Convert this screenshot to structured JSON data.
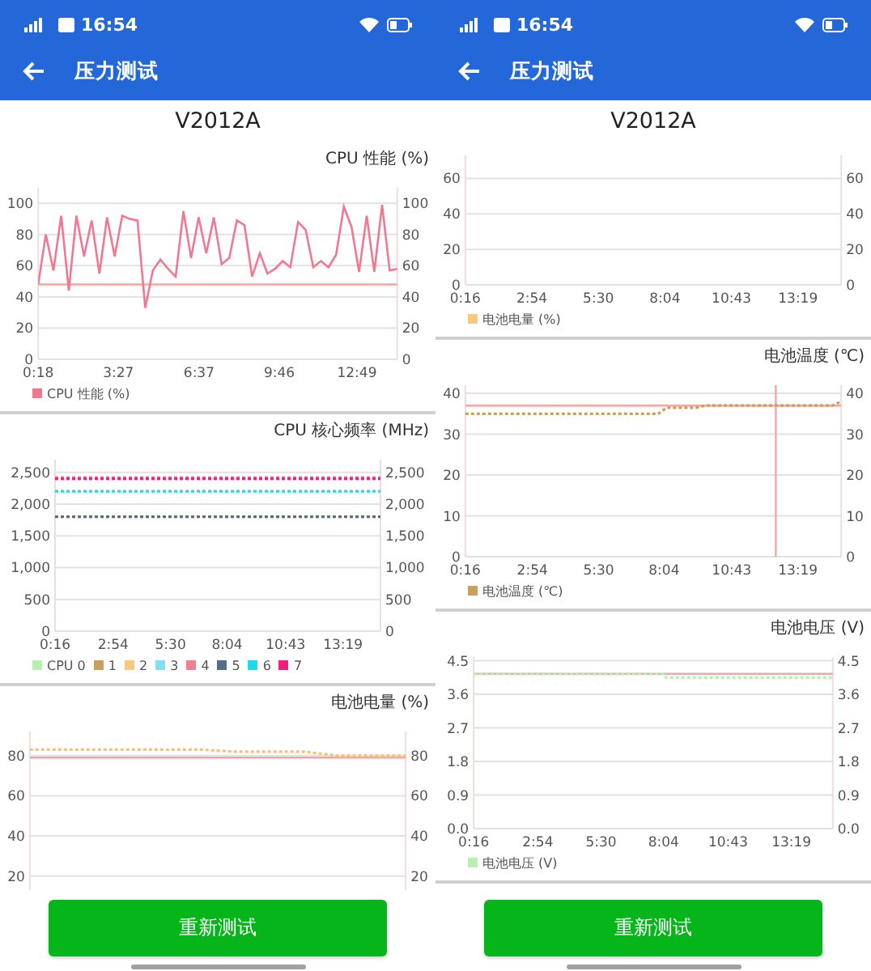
{
  "phones": [
    {
      "status_bar": {
        "time": "16:54"
      },
      "app_bar": {
        "title": "压力测试"
      },
      "device": "V2012A",
      "charts": [
        {
          "chart_data": {
            "type": "line",
            "title": "CPU 性能 (%)",
            "grid": true,
            "legend": "bottom",
            "x": [
              18,
              36,
              54,
              72,
              90,
              108,
              126,
              144,
              162,
              180,
              198,
              216,
              234,
              252,
              270,
              288,
              306,
              324,
              342,
              360,
              378,
              396,
              414,
              432,
              450,
              468,
              486,
              504,
              522,
              540,
              558,
              576,
              594,
              612,
              630,
              648,
              666,
              684,
              702,
              720,
              738,
              756,
              774,
              792,
              810,
              828,
              846,
              864
            ],
            "xlim": [
              18,
              864
            ],
            "ylim": [
              0,
              110
            ],
            "y2lim": [
              0,
              110
            ],
            "yticks": [
              0,
              20,
              40,
              60,
              80,
              100
            ],
            "y2ticks": [
              0,
              20,
              40,
              60,
              80,
              100
            ],
            "xticks": [
              {
                "value": 18,
                "label": "0:18"
              },
              {
                "value": 207,
                "label": "3:27"
              },
              {
                "value": 397,
                "label": "6:37"
              },
              {
                "value": 586,
                "label": "9:46"
              },
              {
                "value": 769,
                "label": "12:49"
              }
            ],
            "series": [
              {
                "name": "CPU 性能 (%)",
                "color": "#f07890",
                "line_style": "solid",
                "values": [
                  48,
                  80,
                  57,
                  92,
                  44,
                  92,
                  66,
                  89,
                  55,
                  91,
                  66,
                  92,
                  90,
                  89,
                  33,
                  57,
                  64,
                  58,
                  53,
                  95,
                  65,
                  91,
                  68,
                  91,
                  61,
                  65,
                  89,
                  86,
                  53,
                  68,
                  55,
                  58,
                  63,
                  59,
                  88,
                  83,
                  59,
                  63,
                  59,
                  67,
                  98,
                  85,
                  56,
                  92,
                  56,
                  99,
                  57,
                  58
                ]
              }
            ],
            "ref_lines": [
              {
                "axis": "y",
                "value": 48
              }
            ]
          }
        },
        {
          "chart_data": {
            "type": "line",
            "title": "CPU 核心频率 (MHz)",
            "grid": true,
            "legend": "bottom",
            "x": [
              16,
              901
            ],
            "xlim": [
              16,
              901
            ],
            "ylim": [
              0,
              2700
            ],
            "y2lim": [
              0,
              2700
            ],
            "yticks": [
              0,
              500,
              {
                "value": 1000,
                "label": "1,000"
              },
              {
                "value": 1500,
                "label": "1,500"
              },
              {
                "value": 2000,
                "label": "2,000"
              },
              {
                "value": 2500,
                "label": "2,500"
              }
            ],
            "y2ticks": [
              0,
              500,
              {
                "value": 1000,
                "label": "1,000"
              },
              {
                "value": 1500,
                "label": "1,500"
              },
              {
                "value": 2000,
                "label": "2,000"
              },
              {
                "value": 2500,
                "label": "2,500"
              }
            ],
            "xticks": [
              {
                "value": 16,
                "label": "0:16"
              },
              {
                "value": 174,
                "label": "2:54"
              },
              {
                "value": 330,
                "label": "5:30"
              },
              {
                "value": 484,
                "label": "8:04"
              },
              {
                "value": 643,
                "label": "10:43"
              },
              {
                "value": 799,
                "label": "13:19"
              }
            ],
            "series": [
              {
                "name": "CPU 0",
                "color": "#b8f0b0",
                "values": [
                  null,
                  null
                ]
              },
              {
                "name": "1",
                "color": "#c8a060",
                "values": [
                  null,
                  null
                ]
              },
              {
                "name": "2",
                "color": "#f8c880",
                "values": [
                  null,
                  null
                ]
              },
              {
                "name": "3",
                "color": "#80e0f0",
                "values": [
                  null,
                  null
                ]
              },
              {
                "name": "4",
                "color": "#f08090",
                "line_style": "dotted",
                "values": [
                  2420,
                  2420
                ]
              },
              {
                "name": "5",
                "color": "#507088",
                "line_style": "dotted",
                "values": [
                  1800,
                  1800
                ]
              },
              {
                "name": "6",
                "color": "#20d8e8",
                "line_style": "dotted",
                "values": [
                  2200,
                  2200
                ]
              },
              {
                "name": "7",
                "color": "#f0207a",
                "line_style": "dotted",
                "values": [
                  2400,
                  2400
                ]
              }
            ]
          }
        },
        {
          "chart_data": {
            "type": "line",
            "title": "电池电量 (%)",
            "grid": true,
            "ylim": [
              13,
              92
            ],
            "y2lim": [
              13,
              92
            ],
            "yticks": [
              20,
              40,
              60,
              80
            ],
            "y2ticks": [
              20,
              40,
              60,
              80
            ],
            "series": [
              {
                "color": "#f8c070",
                "line_style": "dotted",
                "values": [
                  83,
                  83,
                  83,
                  83,
                  83,
                  83,
                  82,
                  82,
                  82,
                  80,
                  80,
                  80
                ]
              }
            ],
            "ref_lines": [
              {
                "axis": "y",
                "value": 79
              }
            ]
          }
        }
      ],
      "button": "重新测试"
    },
    {
      "status_bar": {
        "time": "16:54"
      },
      "app_bar": {
        "title": "压力测试"
      },
      "device": "V2012A",
      "charts": [
        {
          "chart_data": {
            "type": "line",
            "grid": true,
            "legend": "bottom",
            "categories": [
              "0:16",
              "2:54",
              "5:30",
              "8:04",
              "10:43",
              "13:19"
            ],
            "ylim": [
              0,
              73
            ],
            "y2lim": [
              0,
              73
            ],
            "yticks": [
              0,
              20,
              40,
              60
            ],
            "y2ticks": [
              0,
              20,
              40,
              60
            ],
            "series": [
              {
                "name": "电池电量 (%)",
                "color": "#f8c880",
                "values": [
                  null,
                  null,
                  null,
                  null,
                  null,
                  null
                ]
              }
            ]
          }
        },
        {
          "chart_data": {
            "type": "line",
            "title": "电池温度 (℃)",
            "grid": true,
            "legend": "bottom",
            "x": [
              16,
              470,
              490,
              560,
              580,
              880,
              901
            ],
            "xlim": [
              16,
              901
            ],
            "ylim": [
              0,
              42
            ],
            "y2lim": [
              0,
              42
            ],
            "yticks": [
              0,
              10,
              20,
              30,
              40
            ],
            "y2ticks": [
              0,
              10,
              20,
              30,
              40
            ],
            "xticks": [
              {
                "value": 16,
                "label": "0:16"
              },
              {
                "value": 174,
                "label": "2:54"
              },
              {
                "value": 330,
                "label": "5:30"
              },
              {
                "value": 484,
                "label": "8:04"
              },
              {
                "value": 643,
                "label": "10:43"
              },
              {
                "value": 799,
                "label": "13:19"
              }
            ],
            "series": [
              {
                "name": "电池温度 (℃)",
                "color": "#c8a060",
                "line_style": "dotted",
                "values": [
                  35,
                  35,
                  36.5,
                  36.5,
                  37,
                  37,
                  38
                ]
              }
            ],
            "ref_lines": [
              {
                "axis": "y",
                "value": 37
              },
              {
                "axis": "x",
                "value": 747
              }
            ]
          }
        },
        {
          "chart_data": {
            "type": "line",
            "title": "电池电压 (V)",
            "grid": true,
            "legend": "bottom",
            "x": [
              16,
              484,
              490,
              901
            ],
            "xlim": [
              16,
              901
            ],
            "ylim": [
              0,
              4.6
            ],
            "y2lim": [
              0,
              4.6
            ],
            "yticks": [
              {
                "value": 0,
                "label": "0.0"
              },
              0.9,
              1.8,
              2.7,
              3.6,
              4.5
            ],
            "y2ticks": [
              {
                "value": 0,
                "label": "0.0"
              },
              0.9,
              1.8,
              2.7,
              3.6,
              4.5
            ],
            "xticks": [
              {
                "value": 16,
                "label": "0:16"
              },
              {
                "value": 174,
                "label": "2:54"
              },
              {
                "value": 330,
                "label": "5:30"
              },
              {
                "value": 484,
                "label": "8:04"
              },
              {
                "value": 643,
                "label": "10:43"
              },
              {
                "value": 799,
                "label": "13:19"
              }
            ],
            "series": [
              {
                "name": "电池电压 (V)",
                "color": "#b8f0b0",
                "line_style": "dotted",
                "values": [
                  4.15,
                  4.15,
                  4.05,
                  4.05
                ]
              }
            ],
            "ref_lines": [
              {
                "axis": "y",
                "value": 4.15
              }
            ]
          }
        }
      ],
      "button": "重新测试"
    }
  ]
}
